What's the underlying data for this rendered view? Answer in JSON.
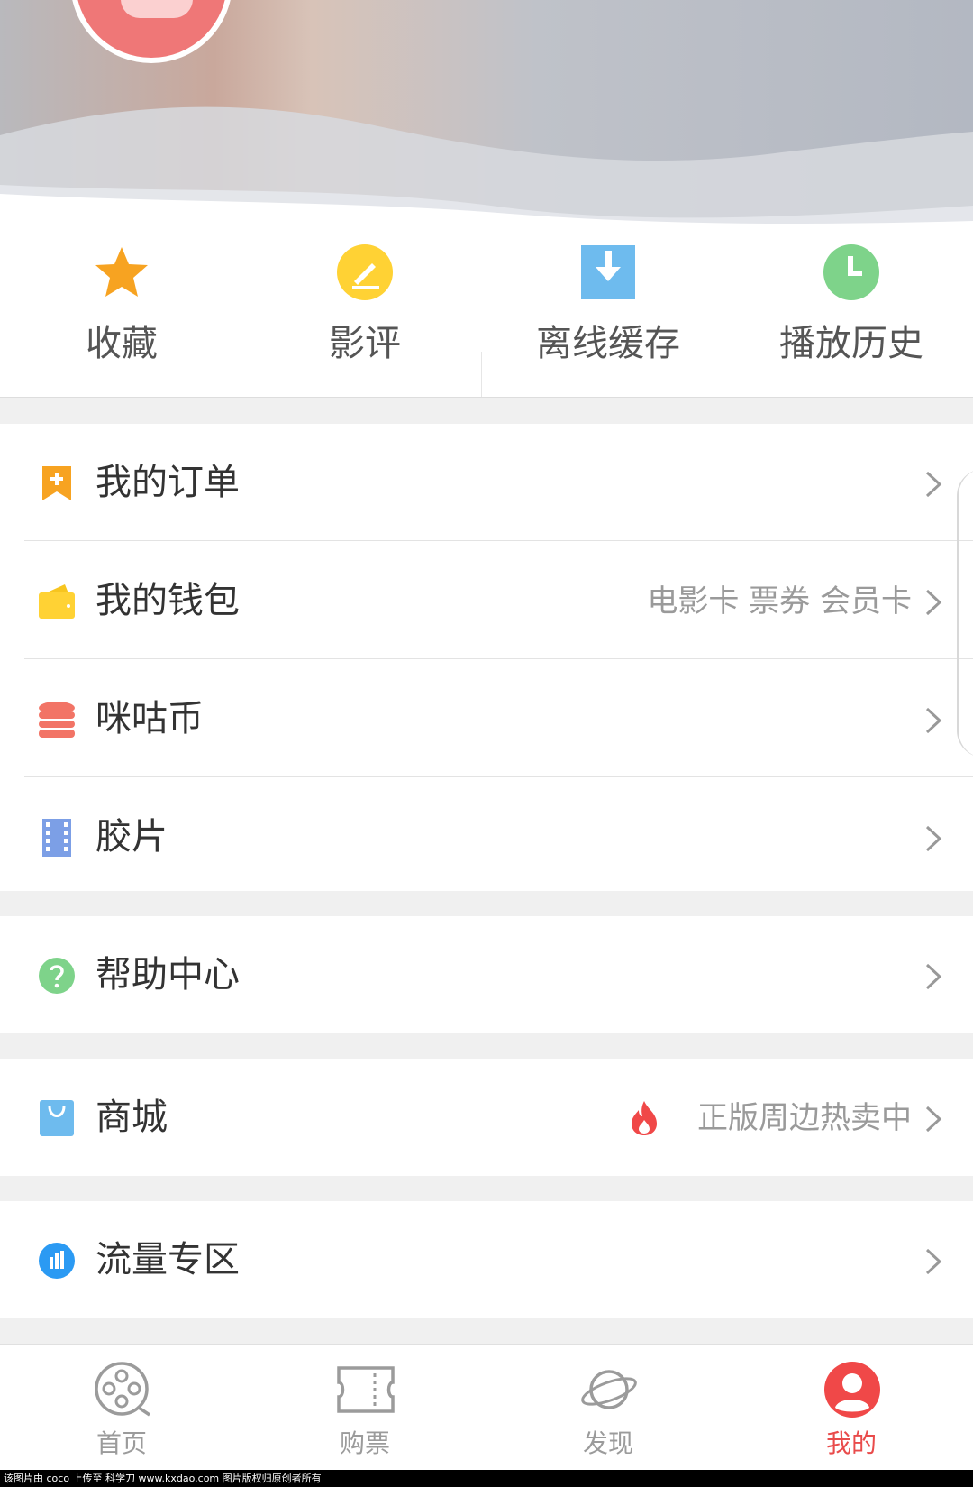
{
  "quick_actions": [
    {
      "label": "收藏",
      "icon": "star-icon",
      "color": "#f7a321"
    },
    {
      "label": "影评",
      "icon": "pen-icon",
      "color": "#ffd234"
    },
    {
      "label": "离线缓存",
      "icon": "download-icon",
      "color": "#6ebbee"
    },
    {
      "label": "播放历史",
      "icon": "clock-icon",
      "color": "#7ed38a"
    }
  ],
  "menu": {
    "orders": {
      "label": "我的订单",
      "icon": "bookmark-plus-icon"
    },
    "wallet": {
      "label": "我的钱包",
      "sub": "电影卡 票券 会员卡",
      "icon": "wallet-icon"
    },
    "coins": {
      "label": "咪咕币",
      "icon": "coins-stack-icon"
    },
    "film": {
      "label": "胶片",
      "icon": "film-strip-icon"
    },
    "help": {
      "label": "帮助中心",
      "icon": "question-icon"
    },
    "mall": {
      "label": "商城",
      "sub": "正版周边热卖中",
      "icon": "shopping-bag-icon",
      "badge_icon": "fire-icon"
    },
    "traffic": {
      "label": "流量专区",
      "icon": "signal-bars-icon"
    }
  },
  "nav": [
    {
      "label": "首页",
      "icon": "film-reel-icon",
      "active": false
    },
    {
      "label": "购票",
      "icon": "ticket-icon",
      "active": false
    },
    {
      "label": "发现",
      "icon": "planet-icon",
      "active": false
    },
    {
      "label": "我的",
      "icon": "user-icon",
      "active": true
    }
  ],
  "colors": {
    "accent": "#e94b4b",
    "inactive": "#9b9b9b"
  },
  "watermark": "该图片由 coco 上传至 科学刀 www.kxdao.com 图片版权归原创者所有"
}
